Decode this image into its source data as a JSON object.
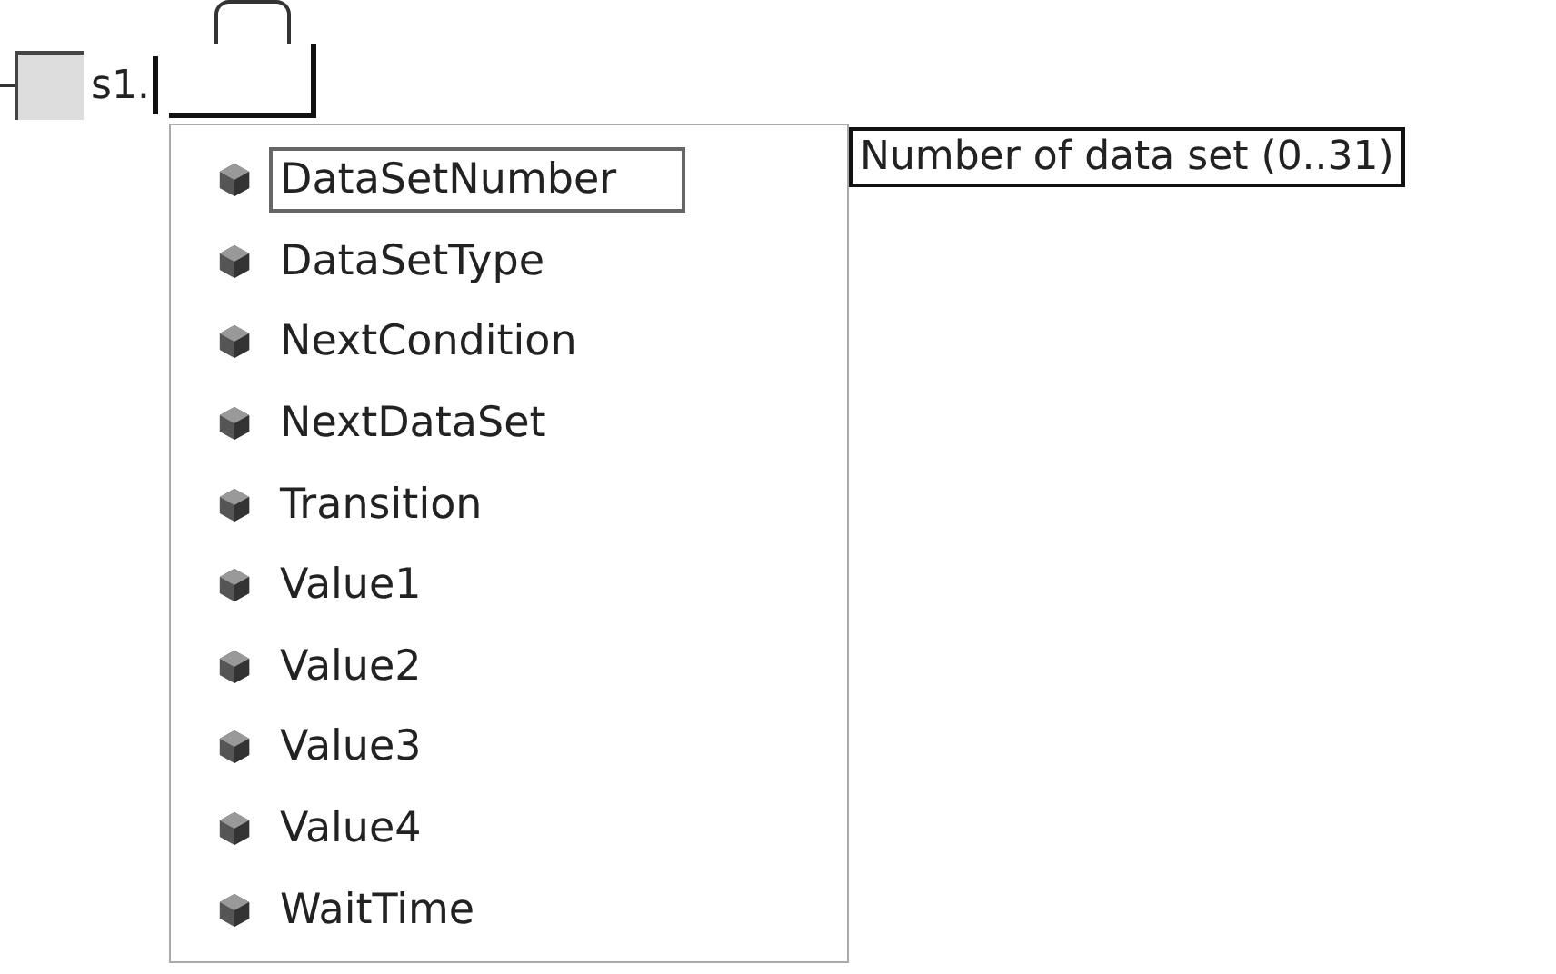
{
  "editor": {
    "typed_text": "s1."
  },
  "completion_list": {
    "items": [
      {
        "label": "DataSetNumber",
        "selected": true
      },
      {
        "label": "DataSetType",
        "selected": false
      },
      {
        "label": "NextCondition",
        "selected": false
      },
      {
        "label": "NextDataSet",
        "selected": false
      },
      {
        "label": "Transition",
        "selected": false
      },
      {
        "label": "Value1",
        "selected": false
      },
      {
        "label": "Value2",
        "selected": false
      },
      {
        "label": "Value3",
        "selected": false
      },
      {
        "label": "Value4",
        "selected": false
      },
      {
        "label": "WaitTime",
        "selected": false
      }
    ]
  },
  "tooltip": {
    "text": "Number of data set (0..31)"
  }
}
